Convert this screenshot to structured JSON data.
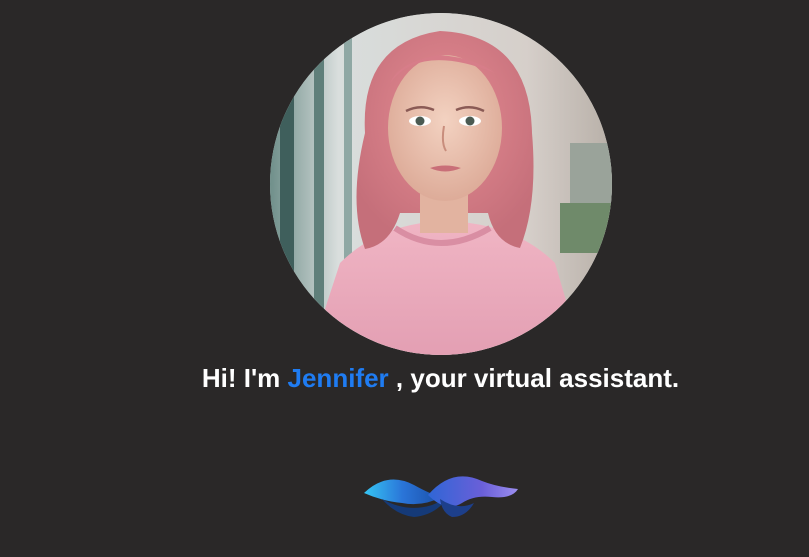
{
  "assistant": {
    "greeting_prefix": "Hi! I'm",
    "name": "Jennifer",
    "greeting_suffix": ", your virtual assistant.",
    "avatar_icon": "assistant-portrait",
    "name_color": "#1f7cf2"
  },
  "voice_indicator": {
    "icon": "voice-wave-icon"
  },
  "colors": {
    "background": "#2a2828",
    "text": "#ffffff",
    "accent": "#1f7cf2"
  }
}
